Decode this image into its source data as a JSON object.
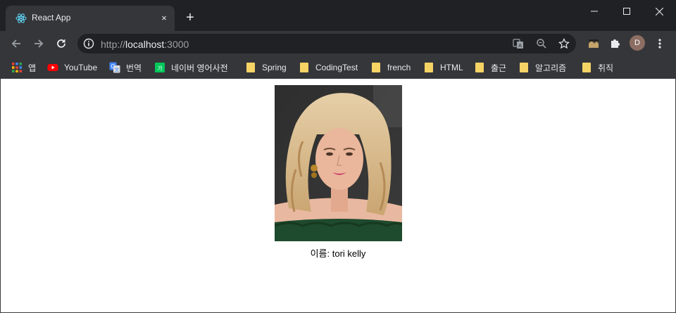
{
  "tab": {
    "title": "React App",
    "favicon": "react-icon",
    "close": "×"
  },
  "newtab": "+",
  "window_controls": [
    "minimize-icon",
    "maximize-icon",
    "close-icon"
  ],
  "address": {
    "scheme": "http://",
    "host": "localhost",
    "port": ":3000"
  },
  "profile": {
    "initial": "D"
  },
  "bookmarks": [
    {
      "label": "앱",
      "icon": "apps-grid-icon"
    },
    {
      "label": "YouTube",
      "icon": "youtube-icon"
    },
    {
      "label": "번역",
      "icon": "google-translate-icon"
    },
    {
      "label": "네이버 영어사전",
      "icon": "naver-dictionary-icon"
    },
    {
      "label": "Spring",
      "icon": "folder-icon"
    },
    {
      "label": "CodingTest",
      "icon": "folder-icon"
    },
    {
      "label": "french",
      "icon": "folder-icon"
    },
    {
      "label": "HTML",
      "icon": "folder-icon"
    },
    {
      "label": "출근",
      "icon": "folder-icon"
    },
    {
      "label": "알고리즘",
      "icon": "folder-icon"
    },
    {
      "label": "취직",
      "icon": "folder-icon"
    }
  ],
  "main": {
    "caption": "이름: tori kelly"
  },
  "colors": {
    "chrome_dark": "#202124",
    "chrome_toolbar": "#35363a",
    "page_bg": "#ffffff",
    "dress": "#1e4a2e",
    "hair": "#d8b98a"
  }
}
